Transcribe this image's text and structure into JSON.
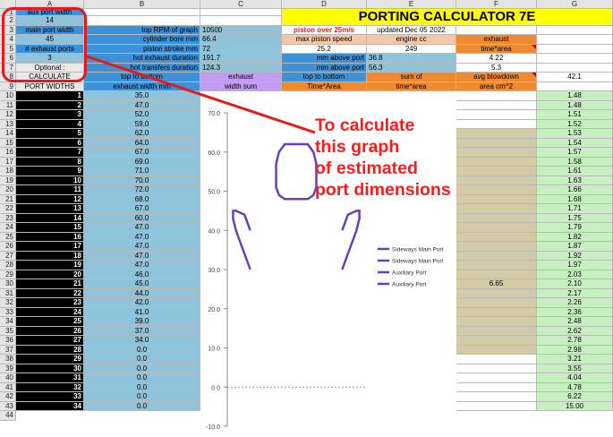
{
  "columns": [
    "A",
    "B",
    "C",
    "D",
    "E",
    "F",
    "G"
  ],
  "title": "PORTING CALCULATOR 7E",
  "params": {
    "a1": "aux port width",
    "a2": "14",
    "a3": "main port width",
    "a4": "45",
    "a5": "# exhaust ports",
    "a6": "3",
    "a7": "Optional :",
    "a8": "CALCULATE",
    "a9": "PORT WIDTHS",
    "b3": "top RPM of graph",
    "c3": "10500",
    "b4": "cylinder bore mm",
    "c4": "66.4",
    "b5": "piston stroke mm",
    "c5": "72",
    "b6": "hot exhaust duration",
    "c6": "191.7",
    "b7": "hot transfers duration",
    "c7": "124.3",
    "b8": "top to bottom",
    "b9": "exhaust width mm",
    "c8": "exhaust",
    "c9": "width sum",
    "d3": "piston over 25m/s",
    "e3": "updated Dec 05 2022",
    "d4": "max piston speed",
    "d5": "25.2",
    "e4": "engine cc",
    "e5": "249",
    "f4": "exhaust",
    "f5": "time*area",
    "f6": "4.22",
    "f7": "5.3",
    "d6": "mm above port",
    "e6": "36.8",
    "d7": "mm above port",
    "e7": "56.3",
    "d8": "top to bottom",
    "d9": "Time*Area",
    "e8": "sum of",
    "e9": "time*area",
    "f8": "avg blowdown",
    "f9": "area cm^2",
    "g8": "42.1",
    "f30": "6.65"
  },
  "rows": {
    "a": [
      "1",
      "2",
      "3",
      "4",
      "5",
      "6",
      "7",
      "8",
      "9",
      "10",
      "11",
      "12",
      "13",
      "14",
      "15",
      "16",
      "17",
      "18",
      "19",
      "20",
      "21",
      "22",
      "23",
      "24",
      "25",
      "26",
      "27",
      "28",
      "29",
      "30",
      "31",
      "32",
      "33",
      "34"
    ],
    "b": [
      "35.0",
      "47.0",
      "52.0",
      "59.0",
      "62.0",
      "64.0",
      "67.0",
      "69.0",
      "71.0",
      "70.0",
      "72.0",
      "68.0",
      "67.0",
      "60.0",
      "47.0",
      "47.0",
      "47.0",
      "47.0",
      "47.0",
      "46.0",
      "45.0",
      "44.0",
      "42.0",
      "41.0",
      "39.0",
      "37.0",
      "34.0",
      "0.0",
      "0.0",
      "0.0",
      "0.0",
      "0.0",
      "0.0",
      "0.0"
    ],
    "g": [
      "1.48",
      "1.48",
      "1.51",
      "1.52",
      "1.53",
      "1.54",
      "1.57",
      "1.58",
      "1.61",
      "1.63",
      "1.66",
      "1.68",
      "1.71",
      "1.75",
      "1.79",
      "1.82",
      "1.87",
      "1.92",
      "1.97",
      "2.03",
      "2.10",
      "2.17",
      "2.26",
      "2.36",
      "2.48",
      "2.62",
      "2.78",
      "2.98",
      "3.21",
      "3.55",
      "4.04",
      "4.78",
      "6.22",
      "15.00"
    ]
  },
  "callout": [
    "To calculate",
    "this graph",
    "of estimated",
    "port dimensions"
  ],
  "chart_data": {
    "type": "line",
    "ylim": [
      -10,
      70
    ],
    "yticks": [
      "70.0",
      "60.0",
      "50.0",
      "40.0",
      "30.0",
      "20.0",
      "10.0",
      "0.0",
      "-10.0"
    ],
    "series": [
      {
        "name": "Sideways Main Port",
        "color": "#6a3fb5",
        "x": [
          -16,
          -18,
          -21,
          -22,
          -22,
          -21,
          -18,
          -16
        ],
        "y": [
          30,
          34,
          40,
          43,
          45,
          45,
          44,
          40
        ]
      },
      {
        "name": "Sideways Main Port",
        "color": "#6a3fb5",
        "x": [
          16,
          18,
          21,
          22,
          22,
          21,
          18,
          16
        ],
        "y": [
          30,
          34,
          40,
          43,
          45,
          45,
          44,
          40
        ]
      },
      {
        "name": "Auxiliary Port",
        "color": "#6a3fb5",
        "x": [
          -7,
          -7,
          -6,
          -4,
          0,
          4,
          6,
          7,
          7
        ],
        "y": [
          54,
          57,
          60,
          62,
          62,
          62,
          60,
          57,
          54
        ]
      },
      {
        "name": "Auxiliary Port",
        "color": "#6a3fb5",
        "x": [
          -7,
          -7,
          -6,
          -4,
          0,
          4,
          6,
          7,
          7
        ],
        "y": [
          54,
          51,
          49,
          48,
          48,
          48,
          49,
          51,
          54
        ]
      }
    ]
  }
}
